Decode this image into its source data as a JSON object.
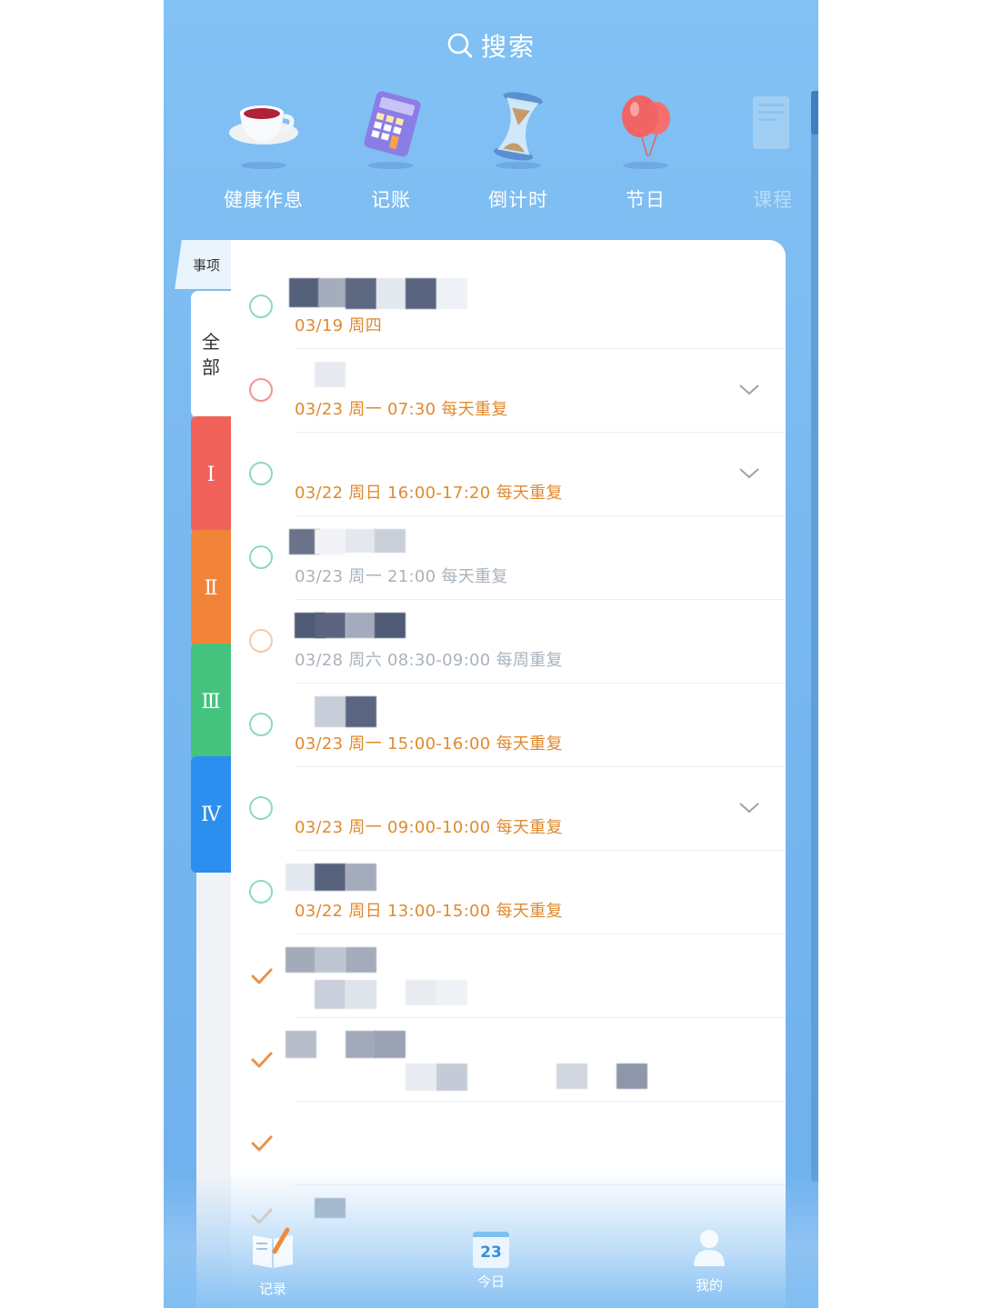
{
  "search": {
    "label": "搜索"
  },
  "categories": [
    {
      "label": "健康作息",
      "icon": "tea-cup-icon"
    },
    {
      "label": "记账",
      "icon": "calculator-icon"
    },
    {
      "label": "倒计时",
      "icon": "hourglass-icon"
    },
    {
      "label": "节日",
      "icon": "balloon-icon"
    },
    {
      "label": "课程",
      "icon": "notebook-icon"
    }
  ],
  "tabs": {
    "top": "事项",
    "all_1": "全",
    "all_2": "部",
    "t1": "Ⅰ",
    "t2": "Ⅱ",
    "t3": "Ⅲ",
    "t4": "Ⅳ"
  },
  "items": [
    {
      "date": "03/19 周四",
      "status": "open",
      "circle": "#8fd8c0",
      "date_color": "#e08a2f",
      "chevron": false
    },
    {
      "date": "03/23 周一 07:30 每天重复",
      "status": "open",
      "circle": "#f0958a",
      "date_color": "#e08a2f",
      "chevron": true
    },
    {
      "date": "03/22 周日 16:00-17:20 每天重复",
      "status": "open",
      "circle": "#8fd8c0",
      "date_color": "#e08a2f",
      "chevron": true
    },
    {
      "date": "03/23 周一 21:00 每天重复",
      "status": "open",
      "circle": "#8fd8c0",
      "date_color": "#a9b3bd",
      "chevron": false
    },
    {
      "date": "03/28 周六 08:30-09:00 每周重复",
      "status": "open",
      "circle": "#f4c9a8",
      "date_color": "#a9b3bd",
      "chevron": false
    },
    {
      "date": "03/23 周一 15:00-16:00 每天重复",
      "status": "open",
      "circle": "#8fd8c0",
      "date_color": "#e08a2f",
      "chevron": false
    },
    {
      "date": "03/23 周一 09:00-10:00 每天重复",
      "status": "open",
      "circle": "#8fd8c0",
      "date_color": "#e08a2f",
      "chevron": true
    },
    {
      "date": "03/22 周日 13:00-15:00 每天重复",
      "status": "open",
      "circle": "#8fd8c0",
      "date_color": "#e08a2f",
      "chevron": false
    },
    {
      "date": "",
      "status": "done",
      "chevron": false
    },
    {
      "date": "",
      "status": "done",
      "chevron": false
    },
    {
      "date": "",
      "status": "done",
      "chevron": false
    },
    {
      "date": "",
      "status": "done",
      "chevron": false
    }
  ],
  "nav": {
    "record": "记录",
    "today": "今日",
    "today_day": "23",
    "mine": "我的"
  },
  "colors": {
    "accent_date": "#e08a2f",
    "muted_date": "#a9b3bd",
    "check": "#e9924a"
  }
}
